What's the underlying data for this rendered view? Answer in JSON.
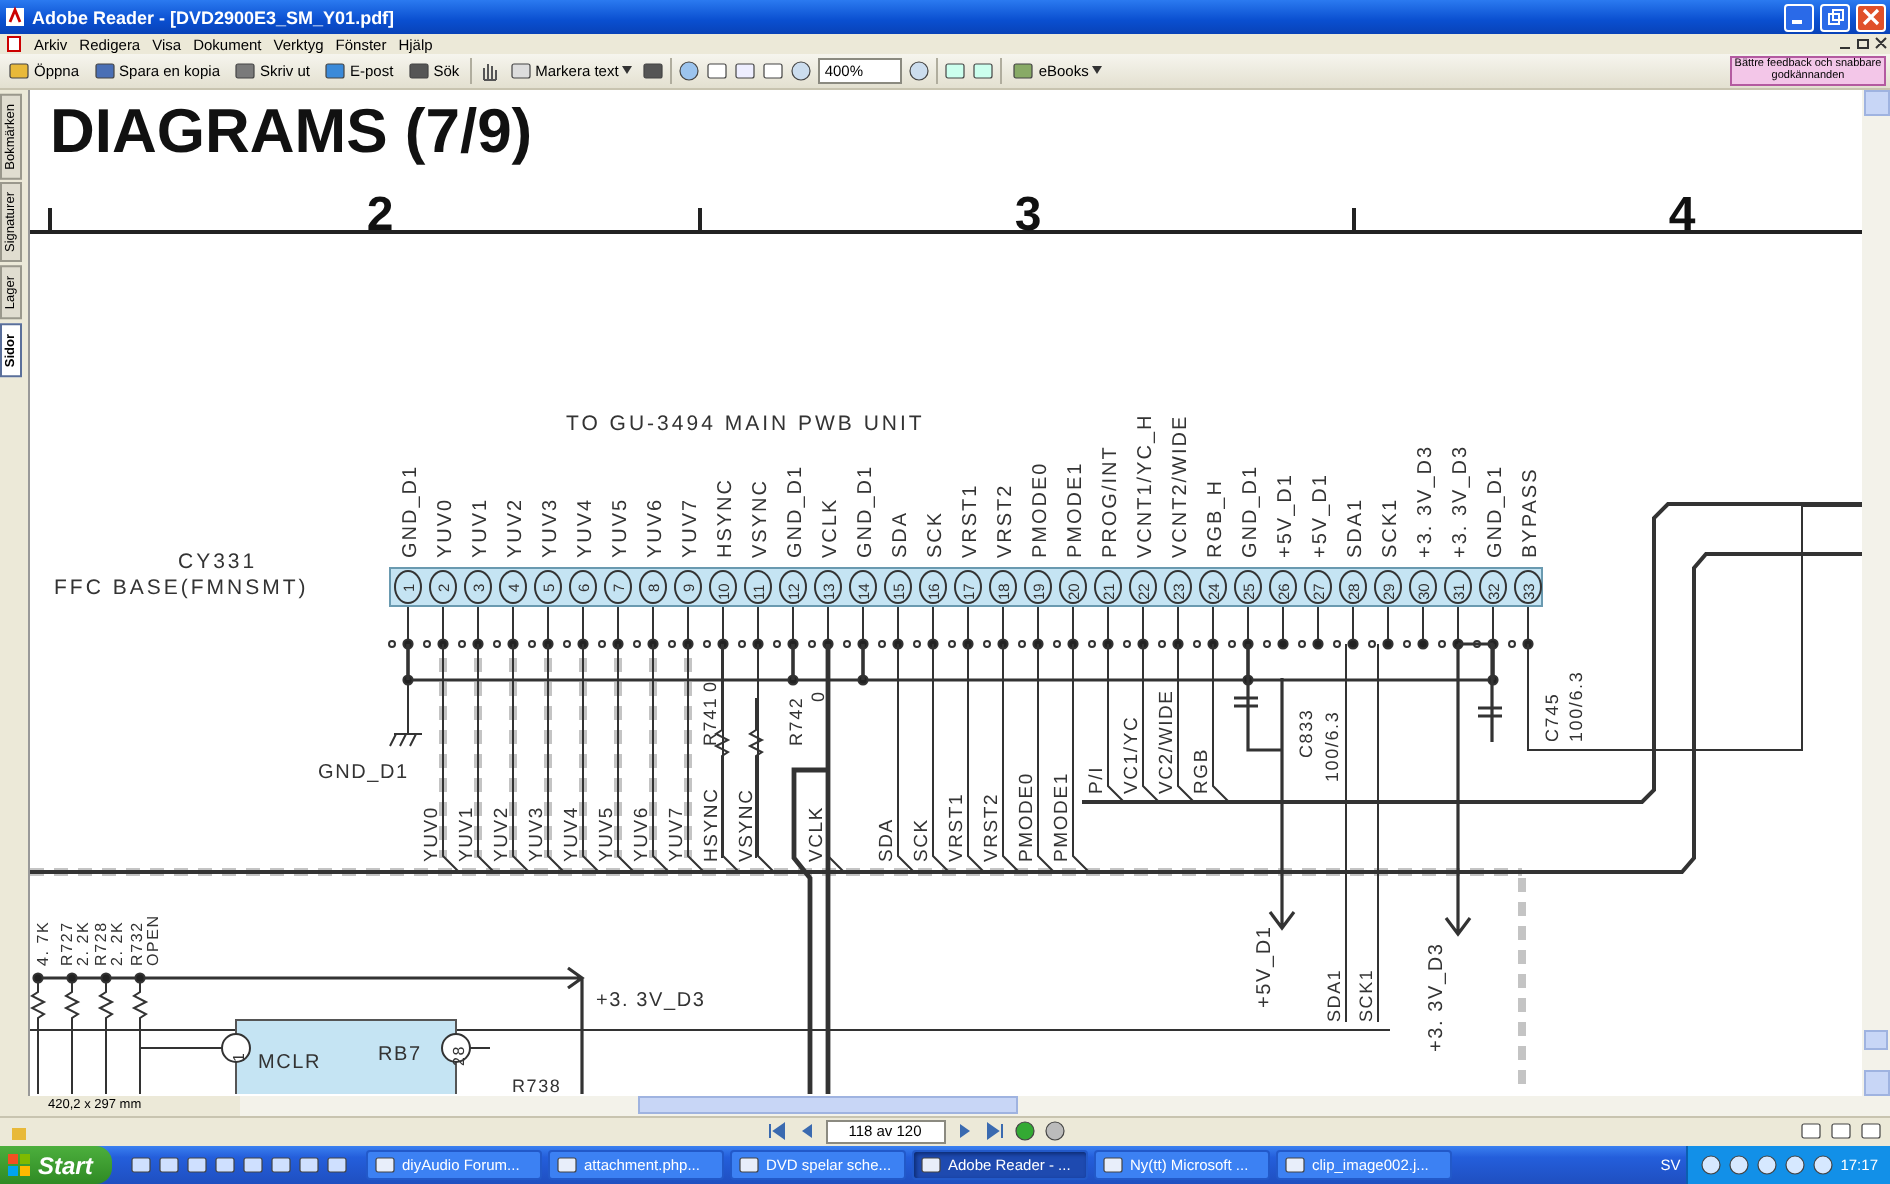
{
  "window": {
    "title": "Adobe Reader - [DVD2900E3_SM_Y01.pdf]"
  },
  "menu": [
    "Arkiv",
    "Redigera",
    "Visa",
    "Dokument",
    "Verktyg",
    "Fönster",
    "Hjälp"
  ],
  "toolbar": {
    "buttons": [
      {
        "label": "Öppna"
      },
      {
        "label": "Spara en kopia"
      },
      {
        "label": "Skriv ut"
      },
      {
        "label": "E-post"
      },
      {
        "label": "Sök"
      }
    ],
    "select_tool": "Markera text",
    "zoom": "400%",
    "ebooks": "eBooks",
    "feedback": "Bättre feedback och snabbare godkännanden"
  },
  "side_tabs": [
    {
      "label": "Bokmärken",
      "selected": false
    },
    {
      "label": "Signaturer",
      "selected": false
    },
    {
      "label": "Lager",
      "selected": false
    },
    {
      "label": "Sidor",
      "selected": true
    }
  ],
  "document": {
    "heading": "DIAGRAMS (7/9)",
    "ruler": [
      "2",
      "3",
      "4"
    ],
    "schematic": {
      "title": "TO GU-3494 MAIN PWB UNIT",
      "connector_ref": "CY331",
      "connector_name": "FFC BASE(FMNSMT)",
      "pins": [
        {
          "number": "1",
          "label": "GND_D1"
        },
        {
          "number": "2",
          "label": "YUV0",
          "net": "YUV0"
        },
        {
          "number": "3",
          "label": "YUV1",
          "net": "YUV1"
        },
        {
          "number": "4",
          "label": "YUV2",
          "net": "YUV2"
        },
        {
          "number": "5",
          "label": "YUV3",
          "net": "YUV3"
        },
        {
          "number": "6",
          "label": "YUV4",
          "net": "YUV4"
        },
        {
          "number": "7",
          "label": "YUV5",
          "net": "YUV5"
        },
        {
          "number": "8",
          "label": "YUV6",
          "net": "YUV6"
        },
        {
          "number": "9",
          "label": "YUV7",
          "net": "YUV7"
        },
        {
          "number": "10",
          "label": "HSYNC",
          "net": "HSYNC"
        },
        {
          "number": "11",
          "label": "VSYNC",
          "net": "VSYNC"
        },
        {
          "number": "12",
          "label": "GND_D1"
        },
        {
          "number": "13",
          "label": "VCLK",
          "net": "VCLK"
        },
        {
          "number": "14",
          "label": "GND_D1"
        },
        {
          "number": "15",
          "label": "SDA",
          "net": "SDA"
        },
        {
          "number": "16",
          "label": "SCK",
          "net": "SCK"
        },
        {
          "number": "17",
          "label": "VRST1",
          "net": "VRST1"
        },
        {
          "number": "18",
          "label": "VRST2",
          "net": "VRST2"
        },
        {
          "number": "19",
          "label": "PMODE0",
          "net": "PMODE0"
        },
        {
          "number": "20",
          "label": "PMODE1",
          "net": "PMODE1"
        },
        {
          "number": "21",
          "label": "PROG/INT",
          "net": "P/I"
        },
        {
          "number": "22",
          "label": "VCNT1/YC_H",
          "net": "VC1/YC"
        },
        {
          "number": "23",
          "label": "VCNT2/WIDE",
          "net": "VC2/WIDE"
        },
        {
          "number": "24",
          "label": "RGB_H",
          "net": "RGB"
        },
        {
          "number": "25",
          "label": "GND_D1"
        },
        {
          "number": "26",
          "label": "+5V_D1"
        },
        {
          "number": "27",
          "label": "+5V_D1"
        },
        {
          "number": "28",
          "label": "SDA1"
        },
        {
          "number": "29",
          "label": "SCK1"
        },
        {
          "number": "30",
          "label": "+3. 3V_D3"
        },
        {
          "number": "31",
          "label": "+3. 3V_D3"
        },
        {
          "number": "32",
          "label": "GND_D1"
        },
        {
          "number": "33",
          "label": "BYPASS"
        }
      ],
      "labels": [
        "GND_D1",
        "R741",
        "0",
        "R742",
        "0",
        "C833",
        "100/6.3",
        "C745",
        "100/6.3",
        "+5V_D1",
        "SDA1",
        "SCK1",
        "+3. 3V_D3",
        "4. 7K",
        "R727",
        "2. 2K",
        "R728",
        "2. 2K",
        "R732",
        "OPEN",
        "+3. 3V_D3",
        "MCLR",
        "RB7",
        "R738",
        "1",
        "28"
      ]
    }
  },
  "page_size": "420,2 x 297 mm",
  "navigation": {
    "page": "118 av 120"
  },
  "taskbar": {
    "start": "Start",
    "tasks": [
      {
        "label": "diyAudio Forum...",
        "selected": false
      },
      {
        "label": "attachment.php...",
        "selected": false
      },
      {
        "label": "DVD spelar sche...",
        "selected": false
      },
      {
        "label": "Adobe Reader - ...",
        "selected": true
      },
      {
        "label": "Ny(tt) Microsoft ...",
        "selected": false
      },
      {
        "label": "clip_image002.j...",
        "selected": false
      }
    ],
    "language": "SV",
    "clock": "17:17"
  }
}
